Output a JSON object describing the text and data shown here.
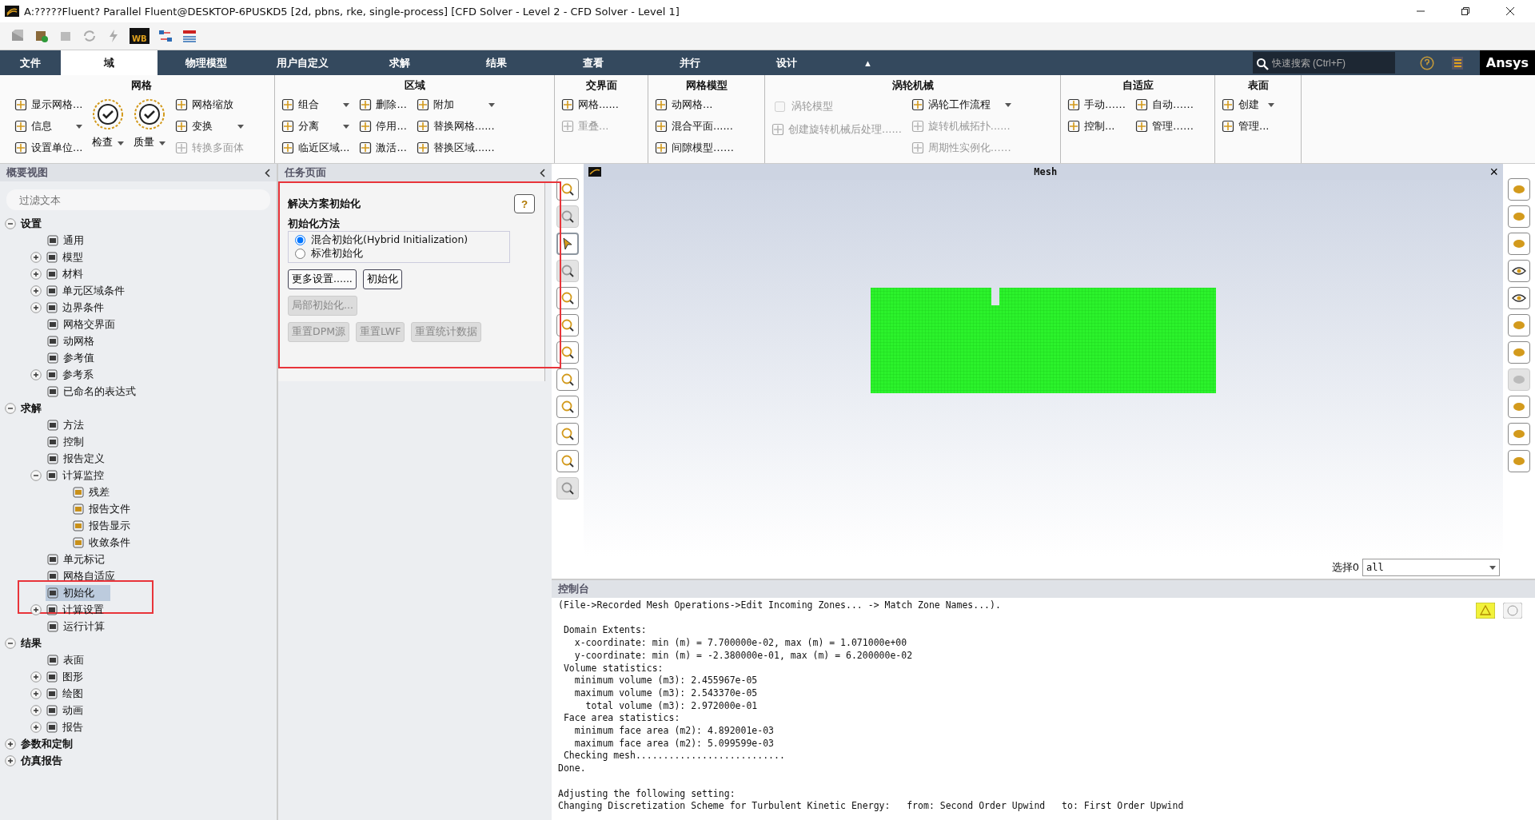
{
  "window": {
    "title": "A:?????Fluent? Parallel Fluent@DESKTOP-6PUSKD5  [2d, pbns, rke, single-process] [CFD Solver - Level 2 - CFD Solver - Level 1]"
  },
  "quick_toolbar": {
    "wb_label": "WB"
  },
  "tabs": [
    {
      "label": "文件",
      "selected": false
    },
    {
      "label": "域",
      "selected": true
    },
    {
      "label": "物理模型",
      "selected": false
    },
    {
      "label": "用户自定义",
      "selected": false
    },
    {
      "label": "求解",
      "selected": false
    },
    {
      "label": "结果",
      "selected": false
    },
    {
      "label": "查看",
      "selected": false
    },
    {
      "label": "并行",
      "selected": false
    },
    {
      "label": "设计",
      "selected": false
    }
  ],
  "collapse_glyph": "▲",
  "search": {
    "placeholder": "快速搜索 (Ctrl+F)"
  },
  "logo": "Ansys",
  "ribbon": [
    {
      "title": "网格",
      "columns": [
        [
          {
            "label": "显示网格...",
            "kind": "small",
            "disabled": false,
            "dropdown": false
          },
          {
            "label": "信息",
            "kind": "small",
            "disabled": false,
            "dropdown": true
          },
          {
            "label": "设置单位...",
            "kind": "small",
            "disabled": false,
            "dropdown": false
          }
        ],
        [
          {
            "label": "检查",
            "kind": "big",
            "disabled": false,
            "dropdown": true
          }
        ],
        [
          {
            "label": "质量",
            "kind": "big",
            "disabled": false,
            "dropdown": true
          }
        ],
        [
          {
            "label": "网格缩放",
            "kind": "small",
            "disabled": false,
            "dropdown": false
          },
          {
            "label": "变换",
            "kind": "small",
            "disabled": false,
            "dropdown": true
          },
          {
            "label": "转换多面体",
            "kind": "small",
            "disabled": true,
            "dropdown": false
          }
        ]
      ]
    },
    {
      "title": "区域",
      "columns": [
        [
          {
            "label": "组合",
            "kind": "small",
            "disabled": false,
            "dropdown": true
          },
          {
            "label": "分离",
            "kind": "small",
            "disabled": false,
            "dropdown": true
          },
          {
            "label": "临近区域...",
            "kind": "small",
            "disabled": false,
            "dropdown": false
          }
        ],
        [
          {
            "label": "删除...",
            "kind": "small",
            "disabled": false,
            "dropdown": false
          },
          {
            "label": "停用...",
            "kind": "small",
            "disabled": false,
            "dropdown": false
          },
          {
            "label": "激活...",
            "kind": "small",
            "disabled": false,
            "dropdown": false
          }
        ],
        [
          {
            "label": "附加",
            "kind": "small",
            "disabled": false,
            "dropdown": true
          },
          {
            "label": "替换网格......",
            "kind": "small",
            "disabled": false,
            "dropdown": false
          },
          {
            "label": "替换区域......",
            "kind": "small",
            "disabled": false,
            "dropdown": false
          }
        ]
      ]
    },
    {
      "title": "交界面",
      "columns": [
        [
          {
            "label": "网格......",
            "kind": "small",
            "disabled": false,
            "dropdown": false
          },
          {
            "label": "重叠...",
            "kind": "small",
            "disabled": true,
            "dropdown": false
          }
        ]
      ]
    },
    {
      "title": "网格模型",
      "columns": [
        [
          {
            "label": "动网格...",
            "kind": "small",
            "disabled": false,
            "dropdown": false
          },
          {
            "label": "混合平面......",
            "kind": "small",
            "disabled": false,
            "dropdown": false
          },
          {
            "label": "间隙模型……",
            "kind": "small",
            "disabled": false,
            "dropdown": false
          }
        ]
      ]
    },
    {
      "title": "涡轮机械",
      "columns": [
        [
          {
            "label": "涡轮模型",
            "kind": "checkbox",
            "checked": false,
            "disabled": true,
            "dropdown": false
          },
          {
            "label": "创建旋转机械后处理......",
            "kind": "small",
            "disabled": true,
            "dropdown": false
          }
        ],
        [
          {
            "label": "涡轮工作流程",
            "kind": "small",
            "disabled": false,
            "dropdown": true
          },
          {
            "label": "旋转机械拓扑......",
            "kind": "small",
            "disabled": true,
            "dropdown": false
          },
          {
            "label": "周期性实例化……",
            "kind": "small",
            "disabled": true,
            "dropdown": false
          }
        ]
      ]
    },
    {
      "title": "自适应",
      "columns": [
        [
          {
            "label": "手动……",
            "kind": "small",
            "disabled": false,
            "dropdown": false
          },
          {
            "label": "控制...",
            "kind": "small",
            "disabled": false,
            "dropdown": false
          }
        ],
        [
          {
            "label": "自动……",
            "kind": "small",
            "disabled": false,
            "dropdown": false
          },
          {
            "label": "管理……",
            "kind": "small",
            "disabled": false,
            "dropdown": false
          }
        ]
      ]
    },
    {
      "title": "表面",
      "columns": [
        [
          {
            "label": "创建",
            "kind": "small",
            "disabled": false,
            "dropdown": true
          },
          {
            "label": "管理...",
            "kind": "small",
            "disabled": false,
            "dropdown": false
          }
        ]
      ]
    }
  ],
  "outline": {
    "title": "概要视图",
    "filter_placeholder": "过滤文本",
    "items": [
      {
        "label": "设置",
        "expanded": true,
        "selected": false,
        "children": [
          {
            "label": "通用",
            "selected": false
          },
          {
            "label": "模型",
            "expanded": false,
            "selected": false
          },
          {
            "label": "材料",
            "expanded": false,
            "selected": false
          },
          {
            "label": "单元区域条件",
            "expanded": false,
            "selected": false
          },
          {
            "label": "边界条件",
            "expanded": false,
            "selected": false
          },
          {
            "label": "网格交界面",
            "selected": false
          },
          {
            "label": "动网格",
            "selected": false
          },
          {
            "label": "参考值",
            "selected": false
          },
          {
            "label": "参考系",
            "expanded": false,
            "selected": false
          },
          {
            "label": "已命名的表达式",
            "selected": false
          }
        ]
      },
      {
        "label": "求解",
        "expanded": true,
        "selected": false,
        "children": [
          {
            "label": "方法",
            "selected": false
          },
          {
            "label": "控制",
            "selected": false
          },
          {
            "label": "报告定义",
            "selected": false
          },
          {
            "label": "计算监控",
            "expanded": true,
            "selected": false,
            "children": [
              {
                "label": "残差",
                "selected": false
              },
              {
                "label": "报告文件",
                "selected": false
              },
              {
                "label": "报告显示",
                "selected": false
              },
              {
                "label": "收敛条件",
                "selected": false
              }
            ]
          },
          {
            "label": "单元标记",
            "selected": false
          },
          {
            "label": "网格自适应",
            "selected": false
          },
          {
            "label": "初始化",
            "selected": true
          },
          {
            "label": "计算设置",
            "expanded": false,
            "selected": false
          },
          {
            "label": "运行计算",
            "selected": false
          }
        ]
      },
      {
        "label": "结果",
        "expanded": true,
        "selected": false,
        "children": [
          {
            "label": "表面",
            "selected": false
          },
          {
            "label": "图形",
            "expanded": false,
            "selected": false
          },
          {
            "label": "绘图",
            "expanded": false,
            "selected": false
          },
          {
            "label": "动画",
            "expanded": false,
            "selected": false
          },
          {
            "label": "报告",
            "expanded": false,
            "selected": false
          }
        ]
      },
      {
        "label": "参数和定制",
        "expanded": false,
        "selected": false
      },
      {
        "label": "仿真报告",
        "expanded": false,
        "selected": false
      }
    ]
  },
  "task_page": {
    "title": "任务页面",
    "heading": "解决方案初始化",
    "help": "?",
    "method_label": "初始化方法",
    "methods": [
      {
        "label": "混合初始化(Hybrid Initialization)",
        "selected": true
      },
      {
        "label": "标准初始化",
        "selected": false
      }
    ],
    "button_rows": [
      [
        {
          "label": "更多设置......",
          "disabled": false
        },
        {
          "label": "初始化",
          "disabled": false
        }
      ],
      [
        {
          "label": "局部初始化...",
          "disabled": true
        }
      ],
      [
        {
          "label": "重置DPM源",
          "disabled": true
        },
        {
          "label": "重置LWF",
          "disabled": true
        },
        {
          "label": "重置统计数据",
          "disabled": true
        }
      ]
    ]
  },
  "graphics": {
    "title": "Mesh",
    "close": "×",
    "left_tools": [
      {
        "selected": false,
        "disabled": false
      },
      {
        "selected": false,
        "disabled": true
      },
      {
        "selected": true,
        "disabled": false
      },
      {
        "selected": false,
        "disabled": true
      },
      {
        "selected": false,
        "disabled": false
      },
      {
        "selected": false,
        "disabled": false
      },
      {
        "selected": false,
        "disabled": false
      },
      {
        "selected": false,
        "disabled": false
      },
      {
        "selected": false,
        "disabled": false
      },
      {
        "selected": false,
        "disabled": false
      },
      {
        "selected": false,
        "disabled": false
      },
      {
        "selected": false,
        "disabled": true
      }
    ],
    "right_tools": [
      {
        "disabled": false
      },
      {
        "disabled": false
      },
      {
        "disabled": false
      },
      {
        "disabled": false
      },
      {
        "disabled": false
      },
      {
        "disabled": false
      },
      {
        "disabled": false
      },
      {
        "disabled": true
      },
      {
        "disabled": false
      },
      {
        "disabled": false
      },
      {
        "disabled": false
      }
    ],
    "selection_label": "选择0",
    "selection_value": "all"
  },
  "console": {
    "title": "控制台",
    "blocks": [
      [
        "(File->Recorded Mesh Operations->Edit Incoming Zones... -> Match Zone Names...)."
      ],
      [
        " Domain Extents:",
        "   x-coordinate: min (m) = 7.700000e-02, max (m) = 1.071000e+00",
        "   y-coordinate: min (m) = -2.380000e-01, max (m) = 6.200000e-02",
        " Volume statistics:",
        "   minimum volume (m3): 2.455967e-05",
        "   maximum volume (m3): 2.543370e-05",
        "     total volume (m3): 2.972000e-01",
        " Face area statistics:",
        "   minimum face area (m2): 4.892001e-03",
        "   maximum face area (m2): 5.099599e-03",
        " Checking mesh...........................",
        "Done."
      ],
      [
        "Adjusting the following setting:",
        "Changing Discretization Scheme for Turbulent Kinetic Energy:   from: Second Order Upwind   to: First Order Upwind"
      ]
    ]
  }
}
